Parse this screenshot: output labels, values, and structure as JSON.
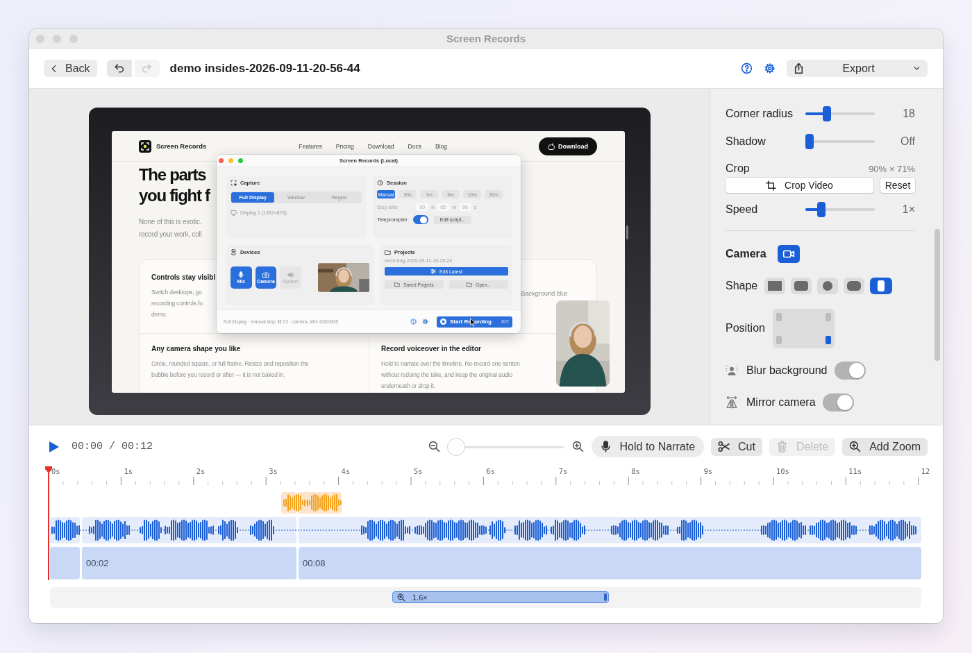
{
  "window": {
    "title": "Screen Records"
  },
  "toolbar": {
    "back": "Back",
    "undo": {
      "disabled": false
    },
    "redo": {
      "disabled": true
    },
    "document": "demo insides-2026-09-11-20-56-44",
    "export": "Export"
  },
  "preview": {
    "page": {
      "brand": "Screen Records",
      "links": [
        "Features",
        "Pricing",
        "Download",
        "Docs",
        "Blog"
      ],
      "download": "Download",
      "hero_title": [
        "The parts",
        "you fight f"
      ],
      "hero_text": [
        "None of this is exotic.",
        "record your work, coll"
      ],
      "features": [
        {
          "title": "Controls stay visibl",
          "text": [
            "Switch desktops, go",
            "recording controls fo",
            "demo."
          ]
        },
        {
          "text": [
            "Background blur"
          ]
        },
        {
          "title": "Any camera shape you like",
          "text": [
            "Circle, rounded square, or full frame. Resize and reposition the",
            "bubble before you record or after — it is not baked in."
          ]
        },
        {
          "title": "Record voiceover in the editor",
          "text": [
            "Hold to narrate over the timeline. Re-record one senten",
            "without redoing the take, and keep the original audio",
            "underneath or drop it."
          ]
        }
      ]
    },
    "recorder": {
      "title": "Screen Records (Local)",
      "capture": {
        "heading": "Capture",
        "modes": [
          {
            "label": "Full Display",
            "selected": true
          },
          {
            "label": "Window",
            "selected": false
          },
          {
            "label": "Region",
            "selected": false
          }
        ],
        "display": "Display 1 (1352×878)"
      },
      "session": {
        "heading": "Session",
        "durations": [
          {
            "label": "Manual",
            "selected": true
          },
          {
            "label": "30s",
            "selected": false
          },
          {
            "label": "1m",
            "selected": false
          },
          {
            "label": "5m",
            "selected": false
          },
          {
            "label": "10m",
            "selected": false
          },
          {
            "label": "30m",
            "selected": false
          }
        ],
        "stop_label": "Stop after",
        "stop_fields": [
          {
            "placeholder": "00",
            "unit": "h"
          },
          {
            "placeholder": "05",
            "unit": "m"
          },
          {
            "placeholder": "00",
            "unit": "s"
          }
        ],
        "teleprompter": {
          "label": "Teleprompter",
          "on": true
        },
        "edit_script": "Edit script..."
      },
      "devices": {
        "heading": "Devices",
        "items": [
          {
            "label": "Mic",
            "kind": "mic",
            "selected": true
          },
          {
            "label": "Camera",
            "kind": "camera",
            "selected": true
          },
          {
            "label": "System",
            "kind": "speaker",
            "selected": false
          }
        ]
      },
      "projects": {
        "heading": "Projects",
        "latest": "recording-2026-09-11-19-25-24",
        "edit_latest": "Edit Latest",
        "saved": "Saved Projects",
        "open": "Open..."
      },
      "footer": {
        "summary": "Full Display · manual stop ⌘⇧2 · camera, WH-1000XM5",
        "start": "Start Recording",
        "shortcut": "⌘R"
      }
    }
  },
  "inspector": {
    "rows": [
      {
        "kind": "slider",
        "label": "Corner radius",
        "level": 0.28,
        "value": "18"
      },
      {
        "kind": "slider",
        "label": "Shadow",
        "level": 0,
        "value": "Off"
      },
      {
        "kind": "crop",
        "label": "Crop",
        "value": "90% × 71%",
        "button": "Crop Video",
        "reset": "Reset"
      },
      {
        "kind": "slider",
        "label": "Speed",
        "level": 0.19,
        "value": "1×"
      }
    ],
    "camera": {
      "heading": "Camera",
      "on": true,
      "shape_label": "Shape",
      "shapes": [
        {
          "kind": "square",
          "selected": false
        },
        {
          "kind": "rounded",
          "selected": false
        },
        {
          "kind": "circle",
          "selected": false
        },
        {
          "kind": "wide",
          "selected": false
        },
        {
          "kind": "portrait",
          "selected": true
        }
      ],
      "position_label": "Position",
      "positions": [
        {
          "selected": false
        },
        {
          "selected": false
        },
        {
          "selected": false
        },
        {
          "selected": true
        }
      ],
      "toggles": [
        {
          "kind": "blur",
          "label": "Blur background",
          "on": true
        },
        {
          "kind": "mirror",
          "label": "Mirror camera",
          "on": true
        }
      ]
    }
  },
  "timeline": {
    "time": "00:00 / 00:12",
    "zoom": {
      "level": 0
    },
    "actions": [
      {
        "kind": "mic",
        "label": "Hold to Narrate",
        "disabled": false
      },
      {
        "kind": "scissors",
        "label": "Cut",
        "disabled": false
      },
      {
        "kind": "trash",
        "label": "Delete",
        "disabled": true
      },
      {
        "kind": "zoom",
        "label": "Add Zoom",
        "disabled": false
      }
    ],
    "ruler": [
      "0s",
      "1s",
      "2s",
      "3s",
      "4s",
      "5s",
      "6s",
      "7s",
      "8s",
      "9s",
      "10s",
      "11s",
      "12"
    ],
    "video_clips": [
      {
        "label": "00:02"
      },
      {
        "label": "00:08"
      }
    ],
    "zoom_segment": {
      "label": "1.6×"
    }
  }
}
